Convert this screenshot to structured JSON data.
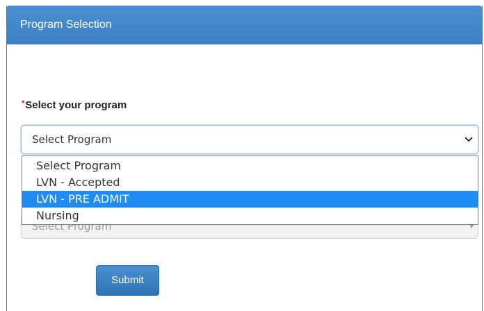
{
  "panel": {
    "title": "Program Selection"
  },
  "form": {
    "program_label": "Select your program",
    "required_marker": "*",
    "program_select": {
      "value": "Select Program",
      "options": [
        "Select Program",
        "LVN - Accepted",
        "LVN - PRE ADMIT",
        "Nursing"
      ],
      "highlighted_index": 2
    },
    "secondary_select": {
      "value": "Select Program"
    },
    "submit_label": "Submit"
  },
  "colors": {
    "header_bg": "#3d80c4",
    "option_highlight": "#1e8cf2",
    "required": "#d9201a"
  }
}
